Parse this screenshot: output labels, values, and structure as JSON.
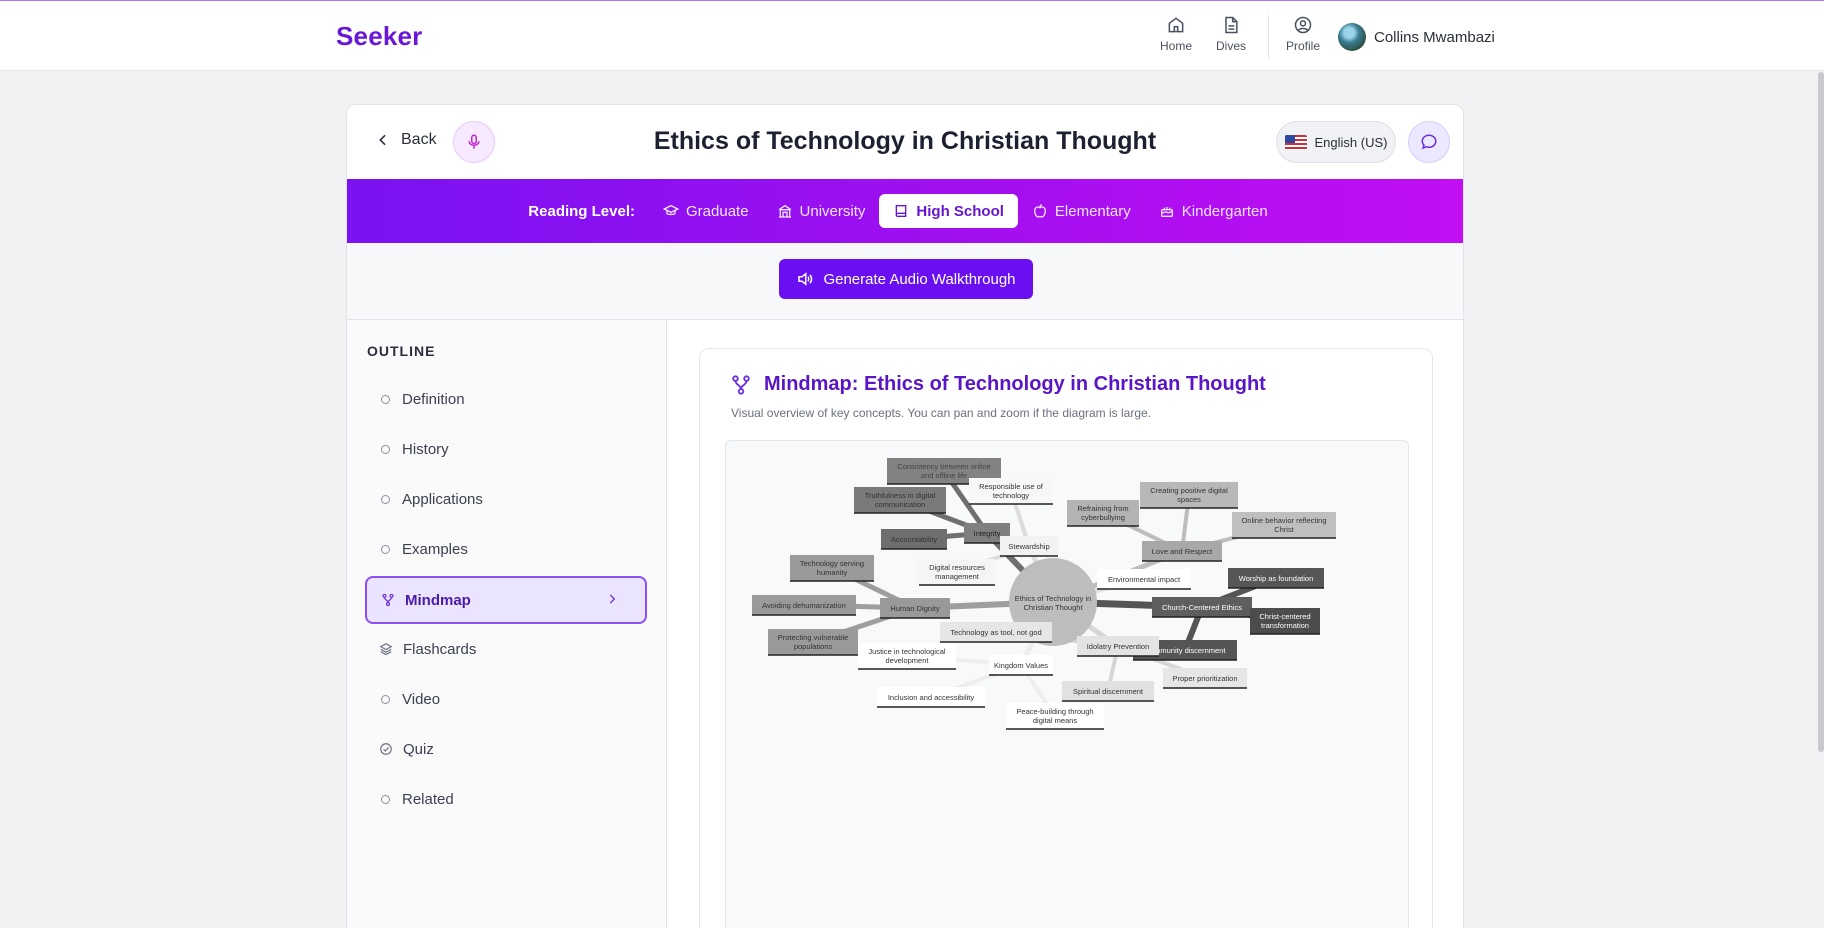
{
  "brand": "Seeker",
  "nav": {
    "home": "Home",
    "dives": "Dives",
    "profile": "Profile",
    "user_name": "Collins Mwambazi"
  },
  "header": {
    "back": "Back",
    "title": "Ethics of Technology in Christian Thought",
    "language": "English (US)"
  },
  "reading_level": {
    "label": "Reading Level:",
    "levels": [
      "Graduate",
      "University",
      "High School",
      "Elementary",
      "Kindergarten"
    ],
    "selected": "High School"
  },
  "audio_button": "Generate Audio Walkthrough",
  "outline": {
    "title": "OUTLINE",
    "items": [
      "Definition",
      "History",
      "Applications",
      "Examples",
      "Mindmap",
      "Flashcards",
      "Video",
      "Quiz",
      "Related"
    ],
    "active": "Mindmap"
  },
  "mindmap": {
    "title_prefix": "Mindmap:",
    "title": "Ethics of Technology in Christian Thought",
    "subtitle": "Visual overview of key concepts. You can pan and zoom if the diagram is large.",
    "center": [
      "Ethics of Technology in",
      "Christian Thought"
    ],
    "branches": [
      {
        "label": [
          "Integrity"
        ],
        "children": [
          [
            "Consistency between online",
            "and offline life"
          ],
          [
            "Truthfulness in digital",
            "communication"
          ],
          [
            "Accountability"
          ]
        ]
      },
      {
        "label": [
          "Stewardship"
        ],
        "children": [
          [
            "Responsible use of",
            "technology"
          ],
          [
            "Digital resources",
            "management"
          ]
        ]
      },
      {
        "label": [
          "Love and Respect"
        ],
        "children": [
          [
            "Refraining from",
            "cyberbullying"
          ],
          [
            "Creating positive digital",
            "spaces"
          ],
          [
            "Online behavior reflecting",
            "Christ"
          ]
        ]
      },
      {
        "label": [
          "Environmental impact"
        ],
        "children": []
      },
      {
        "label": [
          "Church-Centered Ethics"
        ],
        "children": [
          [
            "Worship as foundation"
          ],
          [
            "Christ-centered",
            "transformation"
          ],
          [
            "Community discernment"
          ]
        ]
      },
      {
        "label": [
          "Human Dignity"
        ],
        "children": [
          [
            "Technology serving",
            "humanity"
          ],
          [
            "Avoiding dehumanization"
          ],
          [
            "Protecting vulnerable",
            "populations"
          ]
        ]
      },
      {
        "label": [
          "Idolatry Prevention"
        ],
        "children": [
          [
            "Technology as tool, not god"
          ],
          [
            "Spiritual discernment"
          ],
          [
            "Proper prioritization"
          ]
        ]
      },
      {
        "label": [
          "Kingdom Values"
        ],
        "children": [
          [
            "Justice in technological",
            "development"
          ],
          [
            "Inclusion and accessibility"
          ],
          [
            "Peace-building through",
            "digital means"
          ]
        ]
      }
    ]
  }
}
